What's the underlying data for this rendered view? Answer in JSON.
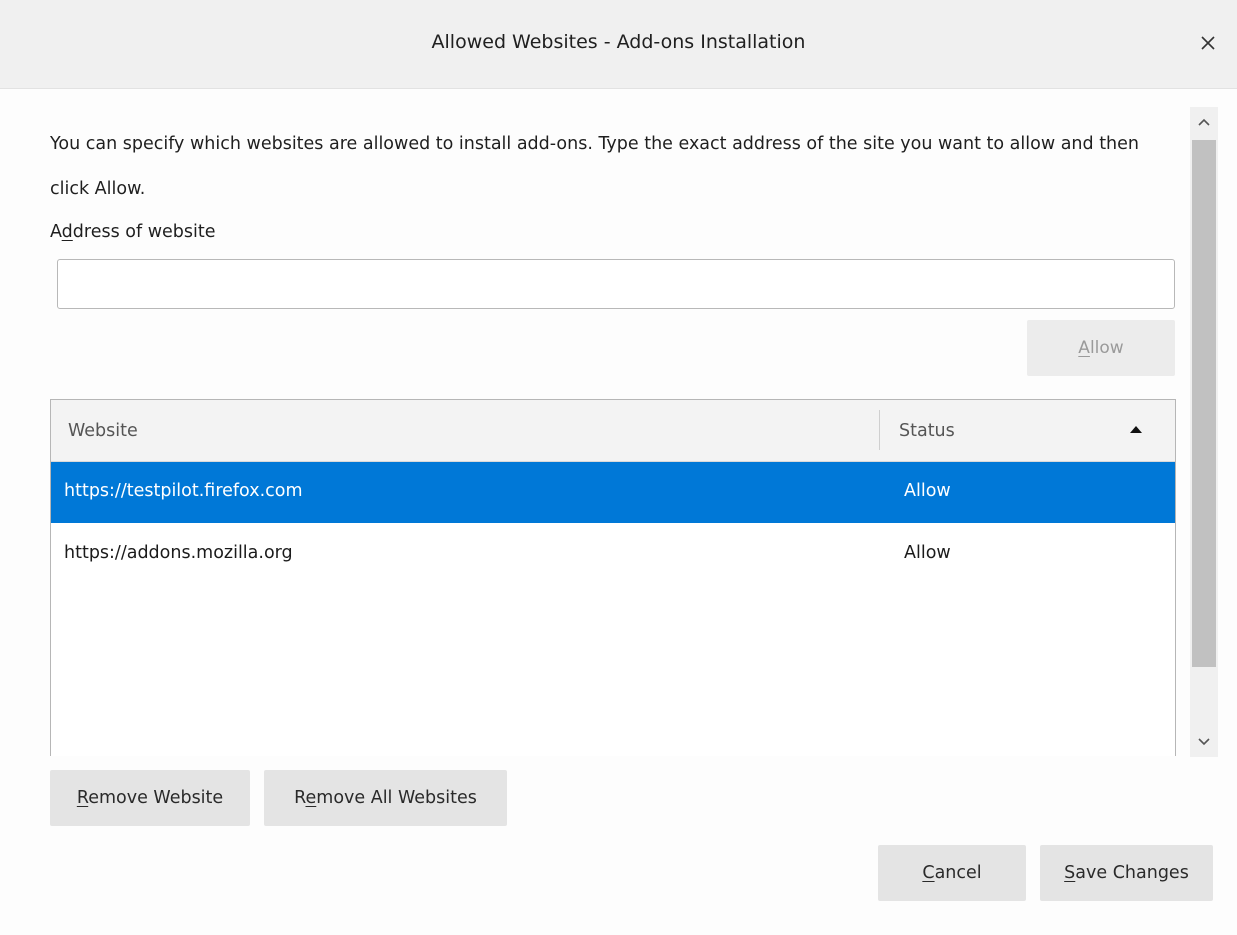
{
  "dialog": {
    "title": "Allowed Websites - Add-ons Installation"
  },
  "description": "You can specify which websites are allowed to install add-ons. Type the exact address of the site you want to allow and then click Allow.",
  "address_field": {
    "label_pre": "A",
    "label_key": "d",
    "label_post": "dress of website",
    "value": "",
    "placeholder": ""
  },
  "allow_button": {
    "key": "A",
    "rest": "llow"
  },
  "table": {
    "columns": {
      "website": "Website",
      "status": "Status"
    },
    "sort_indicator": "ascending",
    "rows": [
      {
        "website": "https://testpilot.firefox.com",
        "status": "Allow",
        "selected": true
      },
      {
        "website": "https://addons.mozilla.org",
        "status": "Allow",
        "selected": false
      }
    ]
  },
  "buttons": {
    "remove_website": {
      "key": "R",
      "rest": "emove Website"
    },
    "remove_all": {
      "pre": "R",
      "key": "e",
      "rest": "move All Websites"
    },
    "cancel": {
      "key": "C",
      "rest": "ancel"
    },
    "save": {
      "key": "S",
      "rest": "ave Changes"
    }
  },
  "colors": {
    "selection": "#0078d7",
    "titlebar": "#f0f0f0"
  },
  "icons": {
    "close": "close-icon",
    "sort": "sort-ascending-icon",
    "scroll_up": "chevron-up-icon",
    "scroll_down": "chevron-down-icon"
  }
}
